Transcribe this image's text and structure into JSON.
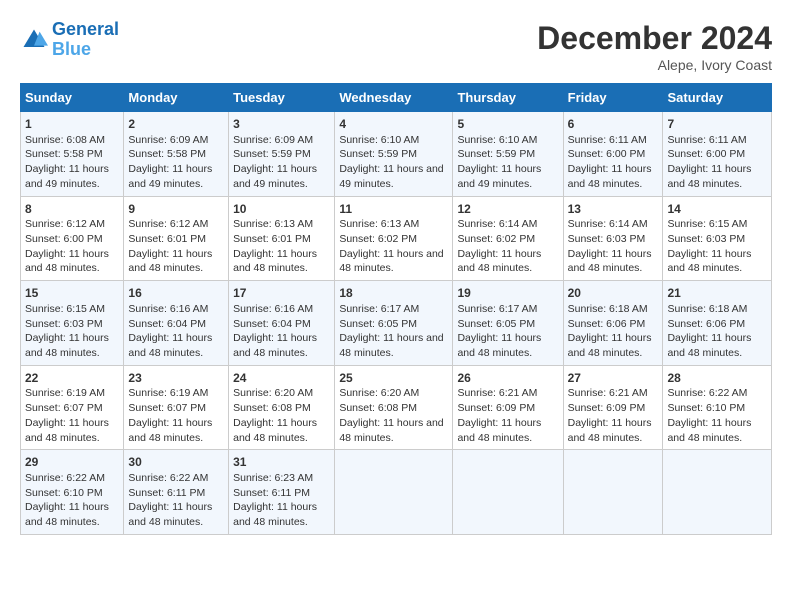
{
  "logo": {
    "line1": "General",
    "line2": "Blue"
  },
  "title": "December 2024",
  "subtitle": "Alepe, Ivory Coast",
  "header_color": "#1a6eb5",
  "days_of_week": [
    "Sunday",
    "Monday",
    "Tuesday",
    "Wednesday",
    "Thursday",
    "Friday",
    "Saturday"
  ],
  "weeks": [
    [
      {
        "day": "1",
        "sunrise": "6:08 AM",
        "sunset": "5:58 PM",
        "daylight": "11 hours and 49 minutes."
      },
      {
        "day": "2",
        "sunrise": "6:09 AM",
        "sunset": "5:58 PM",
        "daylight": "11 hours and 49 minutes."
      },
      {
        "day": "3",
        "sunrise": "6:09 AM",
        "sunset": "5:59 PM",
        "daylight": "11 hours and 49 minutes."
      },
      {
        "day": "4",
        "sunrise": "6:10 AM",
        "sunset": "5:59 PM",
        "daylight": "11 hours and 49 minutes."
      },
      {
        "day": "5",
        "sunrise": "6:10 AM",
        "sunset": "5:59 PM",
        "daylight": "11 hours and 49 minutes."
      },
      {
        "day": "6",
        "sunrise": "6:11 AM",
        "sunset": "6:00 PM",
        "daylight": "11 hours and 48 minutes."
      },
      {
        "day": "7",
        "sunrise": "6:11 AM",
        "sunset": "6:00 PM",
        "daylight": "11 hours and 48 minutes."
      }
    ],
    [
      {
        "day": "8",
        "sunrise": "6:12 AM",
        "sunset": "6:00 PM",
        "daylight": "11 hours and 48 minutes."
      },
      {
        "day": "9",
        "sunrise": "6:12 AM",
        "sunset": "6:01 PM",
        "daylight": "11 hours and 48 minutes."
      },
      {
        "day": "10",
        "sunrise": "6:13 AM",
        "sunset": "6:01 PM",
        "daylight": "11 hours and 48 minutes."
      },
      {
        "day": "11",
        "sunrise": "6:13 AM",
        "sunset": "6:02 PM",
        "daylight": "11 hours and 48 minutes."
      },
      {
        "day": "12",
        "sunrise": "6:14 AM",
        "sunset": "6:02 PM",
        "daylight": "11 hours and 48 minutes."
      },
      {
        "day": "13",
        "sunrise": "6:14 AM",
        "sunset": "6:03 PM",
        "daylight": "11 hours and 48 minutes."
      },
      {
        "day": "14",
        "sunrise": "6:15 AM",
        "sunset": "6:03 PM",
        "daylight": "11 hours and 48 minutes."
      }
    ],
    [
      {
        "day": "15",
        "sunrise": "6:15 AM",
        "sunset": "6:03 PM",
        "daylight": "11 hours and 48 minutes."
      },
      {
        "day": "16",
        "sunrise": "6:16 AM",
        "sunset": "6:04 PM",
        "daylight": "11 hours and 48 minutes."
      },
      {
        "day": "17",
        "sunrise": "6:16 AM",
        "sunset": "6:04 PM",
        "daylight": "11 hours and 48 minutes."
      },
      {
        "day": "18",
        "sunrise": "6:17 AM",
        "sunset": "6:05 PM",
        "daylight": "11 hours and 48 minutes."
      },
      {
        "day": "19",
        "sunrise": "6:17 AM",
        "sunset": "6:05 PM",
        "daylight": "11 hours and 48 minutes."
      },
      {
        "day": "20",
        "sunrise": "6:18 AM",
        "sunset": "6:06 PM",
        "daylight": "11 hours and 48 minutes."
      },
      {
        "day": "21",
        "sunrise": "6:18 AM",
        "sunset": "6:06 PM",
        "daylight": "11 hours and 48 minutes."
      }
    ],
    [
      {
        "day": "22",
        "sunrise": "6:19 AM",
        "sunset": "6:07 PM",
        "daylight": "11 hours and 48 minutes."
      },
      {
        "day": "23",
        "sunrise": "6:19 AM",
        "sunset": "6:07 PM",
        "daylight": "11 hours and 48 minutes."
      },
      {
        "day": "24",
        "sunrise": "6:20 AM",
        "sunset": "6:08 PM",
        "daylight": "11 hours and 48 minutes."
      },
      {
        "day": "25",
        "sunrise": "6:20 AM",
        "sunset": "6:08 PM",
        "daylight": "11 hours and 48 minutes."
      },
      {
        "day": "26",
        "sunrise": "6:21 AM",
        "sunset": "6:09 PM",
        "daylight": "11 hours and 48 minutes."
      },
      {
        "day": "27",
        "sunrise": "6:21 AM",
        "sunset": "6:09 PM",
        "daylight": "11 hours and 48 minutes."
      },
      {
        "day": "28",
        "sunrise": "6:22 AM",
        "sunset": "6:10 PM",
        "daylight": "11 hours and 48 minutes."
      }
    ],
    [
      {
        "day": "29",
        "sunrise": "6:22 AM",
        "sunset": "6:10 PM",
        "daylight": "11 hours and 48 minutes."
      },
      {
        "day": "30",
        "sunrise": "6:22 AM",
        "sunset": "6:11 PM",
        "daylight": "11 hours and 48 minutes."
      },
      {
        "day": "31",
        "sunrise": "6:23 AM",
        "sunset": "6:11 PM",
        "daylight": "11 hours and 48 minutes."
      },
      {
        "day": "",
        "sunrise": "",
        "sunset": "",
        "daylight": ""
      },
      {
        "day": "",
        "sunrise": "",
        "sunset": "",
        "daylight": ""
      },
      {
        "day": "",
        "sunrise": "",
        "sunset": "",
        "daylight": ""
      },
      {
        "day": "",
        "sunrise": "",
        "sunset": "",
        "daylight": ""
      }
    ]
  ]
}
